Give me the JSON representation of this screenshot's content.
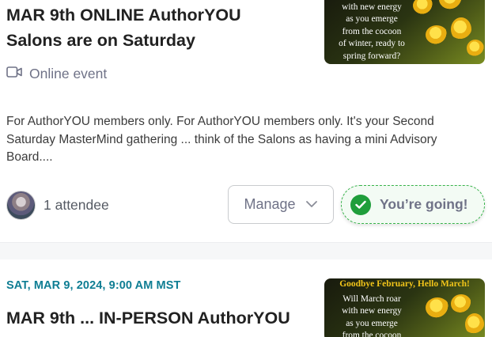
{
  "events": [
    {
      "title_line1": "MAR 9th ONLINE AuthorYOU",
      "title_line2": "Salons are on Saturday",
      "location_type": "Online event",
      "location_icon": "video-camera-icon",
      "description": "For AuthorYOU members only. For AuthorYOU members only. It's your Second Saturday MasterMind gathering ... think of the Salons as having a mini Advisory Board....",
      "attendees_label": "1 attendee",
      "manage_label": "Manage",
      "going_label": "You’re going!",
      "image_text": [
        "with new energy",
        "as you emerge",
        "from the cocoon",
        "of winter, ready to",
        "spring forward?"
      ]
    },
    {
      "date": "SAT, MAR 9, 2024, 9:00 AM MST",
      "title_line1": "MAR 9th ... IN-PERSON AuthorYOU",
      "image_heading": "Goodbye February, Hello March!",
      "image_text": [
        "Will March roar",
        "with new energy",
        "as you emerge",
        "from the cocoon"
      ]
    }
  ],
  "colors": {
    "accent_teal": "#0e7d93",
    "going_green": "#1f9e3b",
    "muted_text": "#6f7287"
  }
}
